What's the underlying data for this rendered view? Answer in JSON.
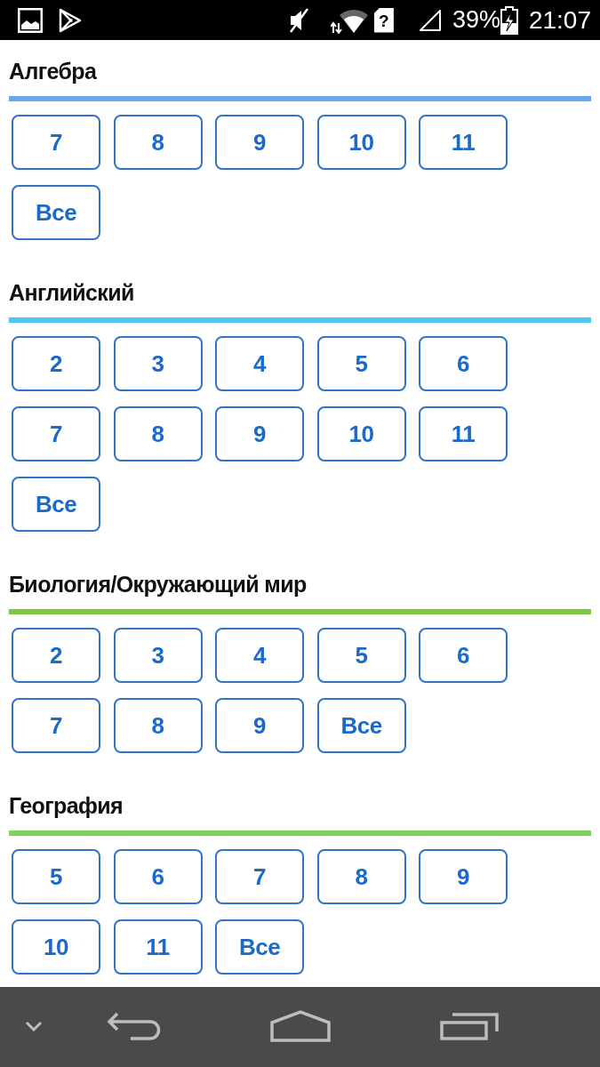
{
  "status_bar": {
    "sim_status": "?",
    "battery": "39%",
    "time": "21:07"
  },
  "sections": [
    {
      "title": "Алгебра",
      "color": "#6aa6ee",
      "grades": [
        "7",
        "8",
        "9",
        "10",
        "11",
        "Все"
      ]
    },
    {
      "title": "Английский",
      "color": "#4ec4f2",
      "grades": [
        "2",
        "3",
        "4",
        "5",
        "6",
        "7",
        "8",
        "9",
        "10",
        "11",
        "Все"
      ]
    },
    {
      "title": "Биология/Окружающий мир",
      "color": "#7dc944",
      "grades": [
        "2",
        "3",
        "4",
        "5",
        "6",
        "7",
        "8",
        "9",
        "Все"
      ]
    },
    {
      "title": "География",
      "color": "#7ed35c",
      "grades": [
        "5",
        "6",
        "7",
        "8",
        "9",
        "10",
        "11",
        "Все"
      ]
    }
  ]
}
